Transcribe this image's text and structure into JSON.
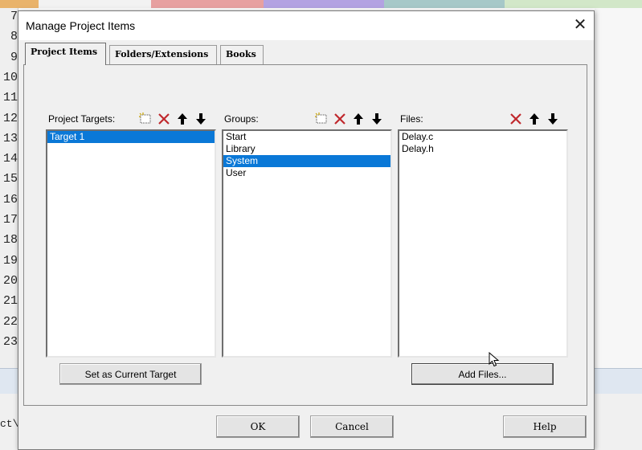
{
  "background": {
    "line_numbers": [
      "7",
      "8",
      "9",
      "10",
      "11",
      "12",
      "13",
      "14",
      "15",
      "16",
      "17",
      "18",
      "19",
      "20",
      "21",
      "22",
      "23"
    ],
    "tab_colors": [
      "#f2f2f2",
      "#e7a0a0",
      "#b3a2e2",
      "#a6c8c8",
      "#d2e7c8"
    ],
    "bottom_text": "ct\\"
  },
  "dialog": {
    "title": "Manage Project Items",
    "close_glyph": "✕",
    "tabs": [
      {
        "label": "Project Items",
        "active": true
      },
      {
        "label": "Folders/Extensions",
        "active": false
      },
      {
        "label": "Books",
        "active": false
      }
    ],
    "targets": {
      "label": "Project Targets:",
      "items": [
        {
          "text": "Target 1",
          "selected": true
        }
      ]
    },
    "groups": {
      "label": "Groups:",
      "items": [
        {
          "text": "Start",
          "selected": false
        },
        {
          "text": "Library",
          "selected": false
        },
        {
          "text": "System",
          "selected": true
        },
        {
          "text": "User",
          "selected": false
        }
      ]
    },
    "files": {
      "label": "Files:",
      "items": [
        {
          "text": "Delay.c",
          "selected": false
        },
        {
          "text": "Delay.h",
          "selected": false
        }
      ]
    },
    "set_current_target_label": "Set as Current Target",
    "add_files_label": "Add Files...",
    "ok_label": "OK",
    "cancel_label": "Cancel",
    "help_label": "Help",
    "icons": {
      "new": "new-item-icon",
      "delete": "delete-x-icon",
      "up": "move-up-icon",
      "down": "move-down-icon",
      "accent_delete": "#c0282d",
      "selection": "#0a78d7"
    }
  }
}
